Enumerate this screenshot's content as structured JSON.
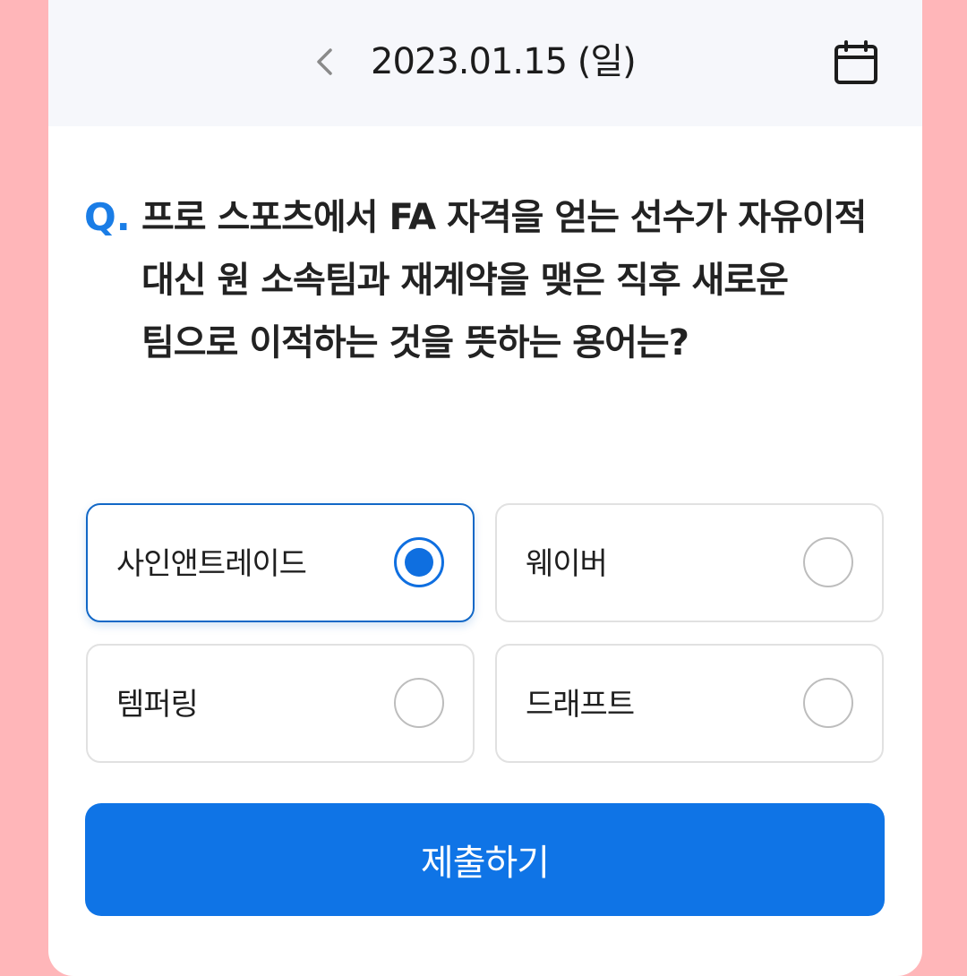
{
  "header": {
    "date": "2023.01.15 (일)",
    "back_icon": "chevron-left-icon",
    "calendar_icon": "calendar-icon"
  },
  "question": {
    "prefix": "Q.",
    "text": "프로 스포츠에서 FA 자격을 얻는 선수가 자유이적 대신 원 소속팀과 재계약을 맺은 직후 새로운 팀으로 이적하는 것을 뜻하는 용어는?"
  },
  "options": [
    {
      "label": "사인앤트레이드",
      "selected": true
    },
    {
      "label": "웨이버",
      "selected": false
    },
    {
      "label": "템퍼링",
      "selected": false
    },
    {
      "label": "드래프트",
      "selected": false
    }
  ],
  "submit": {
    "label": "제출하기"
  },
  "colors": {
    "background": "#ffb6b9",
    "header_bg": "#f6f7fb",
    "accent": "#0f74e6",
    "question_mark": "#1a7de6"
  }
}
